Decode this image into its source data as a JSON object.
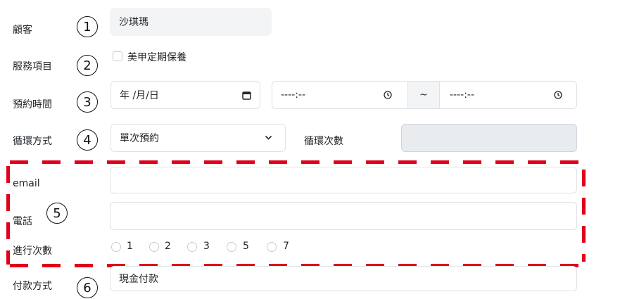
{
  "markers": [
    "1",
    "2",
    "3",
    "4",
    "5",
    "6"
  ],
  "customer": {
    "label": "顧客",
    "value": "沙琪瑪"
  },
  "service": {
    "label": "服務項目",
    "option": "美甲定期保養"
  },
  "appointment": {
    "label": "預約時間",
    "date_placeholder": "年 /月/日",
    "start_time": "----:--",
    "separator": "~",
    "end_time": "----:--"
  },
  "recurrence": {
    "label": "循環方式",
    "selected": "單次預約",
    "count_label": "循環次數"
  },
  "contact": {
    "email_label": "email",
    "phone_label": "電話",
    "visits_label": "進行次數",
    "visit_options": [
      "1",
      "2",
      "3",
      "5",
      "7"
    ]
  },
  "payment": {
    "label": "付款方式",
    "value": "現金付款"
  },
  "colors": {
    "highlight": "#e0001b",
    "border": "#dee2e6",
    "readonly_bg": "#f3f4f6"
  }
}
